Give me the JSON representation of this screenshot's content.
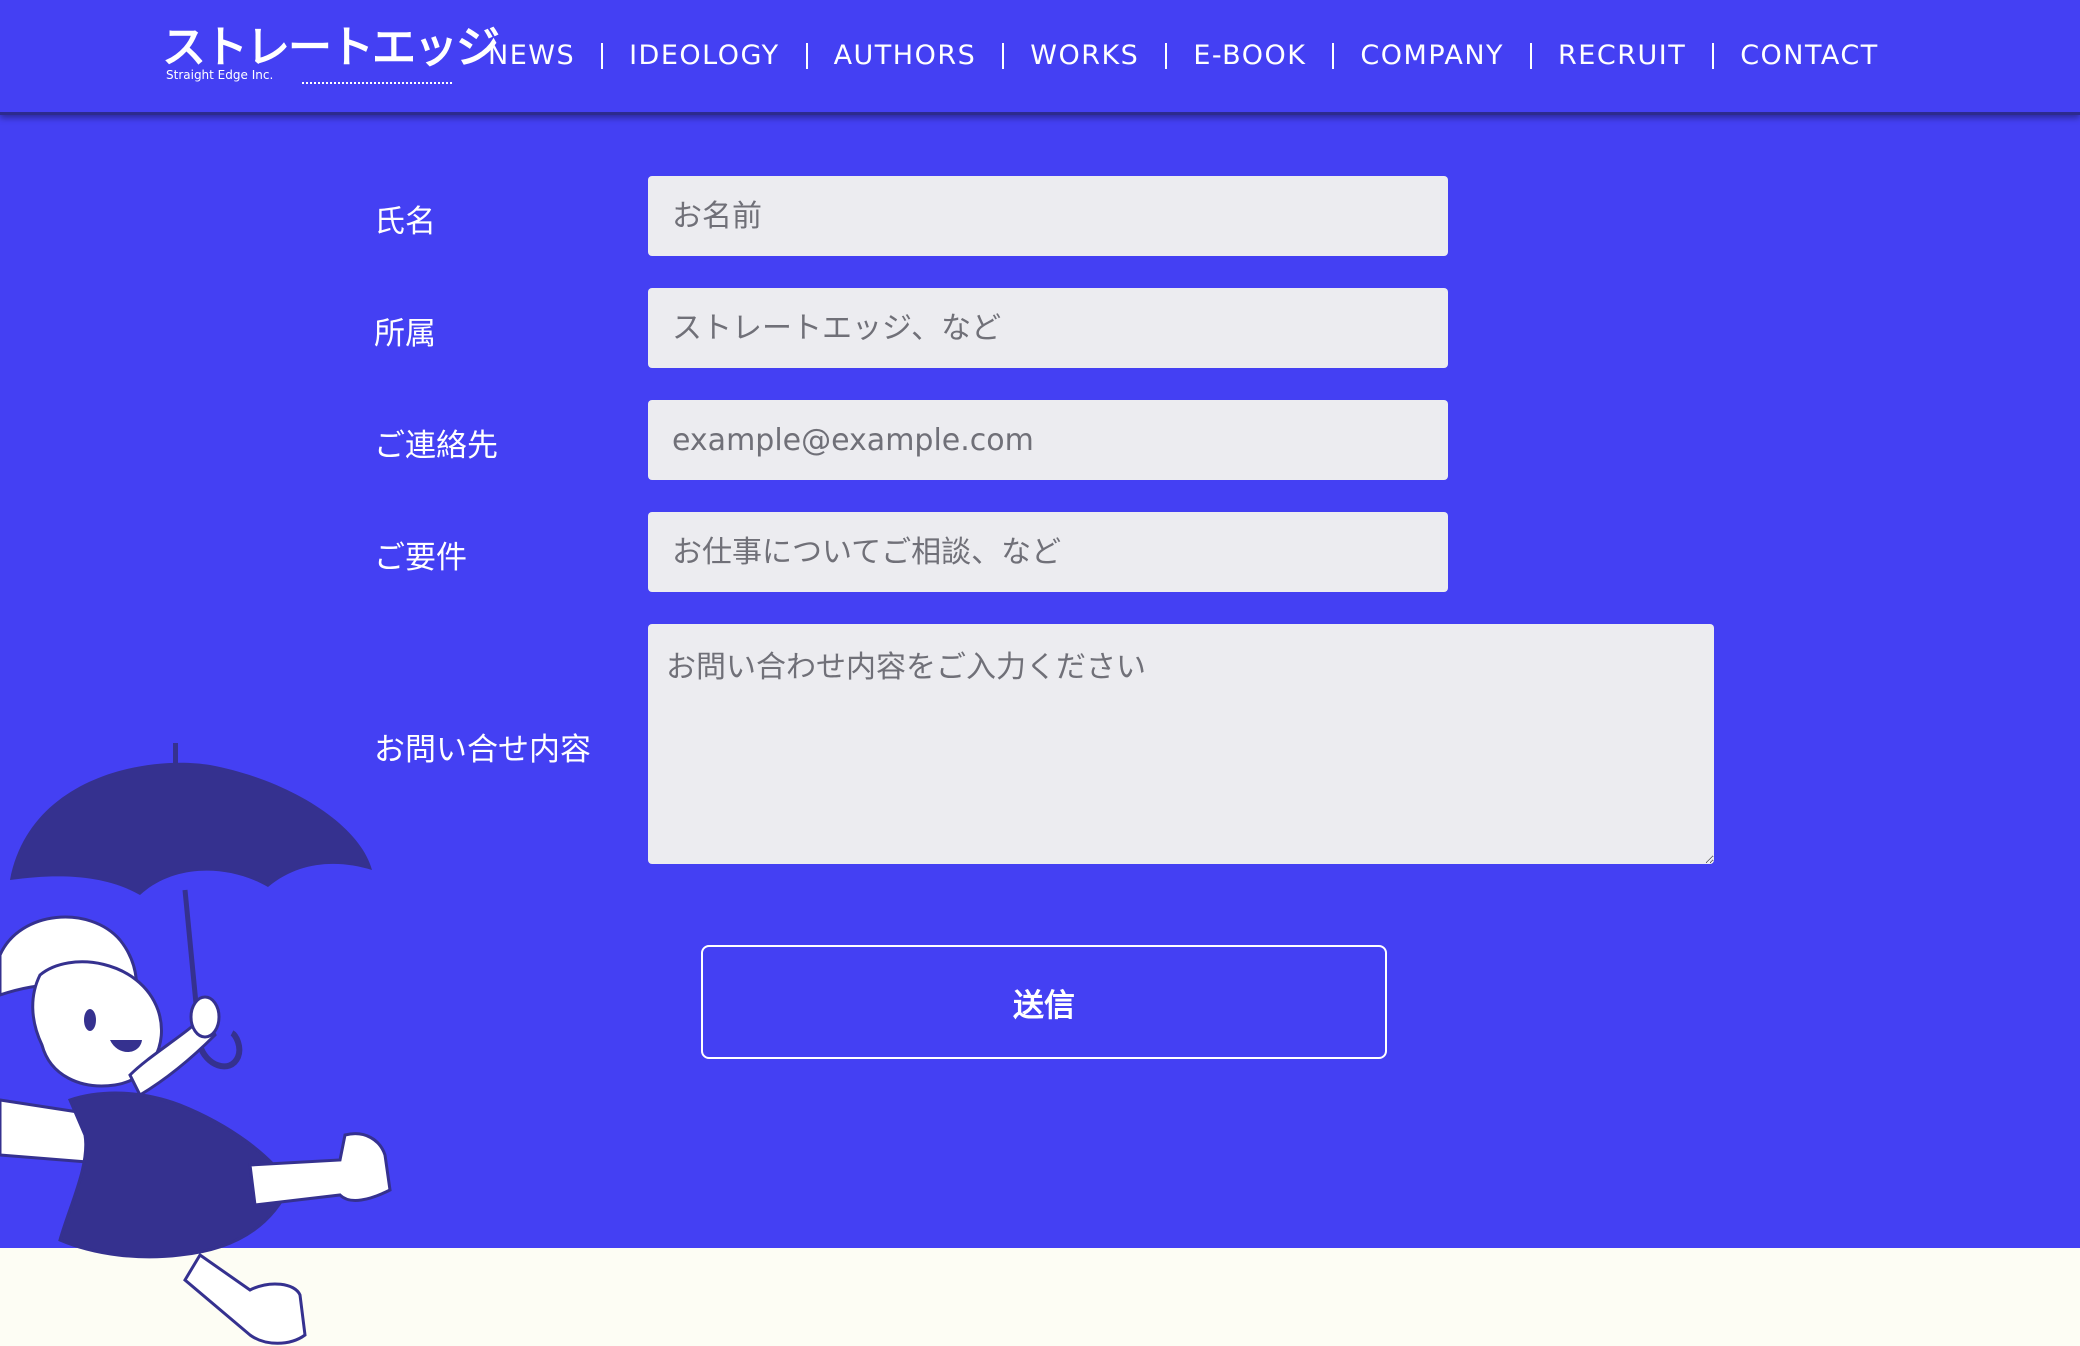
{
  "header": {
    "logo_text": "ストレートエッジ",
    "logo_subtext": "Straight Edge Inc.",
    "nav": [
      "NEWS",
      "IDEOLOGY",
      "AUTHORS",
      "WORKS",
      "E-BOOK",
      "COMPANY",
      "RECRUIT",
      "CONTACT"
    ]
  },
  "form": {
    "name_label": "氏名",
    "name_placeholder": "お名前",
    "affiliation_label": "所属",
    "affiliation_placeholder": "ストレートエッジ、など",
    "contact_label": "ご連絡先",
    "contact_placeholder": "example@example.com",
    "subject_label": "ご要件",
    "subject_placeholder": "お仕事についてご相談、など",
    "message_label": "お問い合せ内容",
    "message_placeholder": "お問い合わせ内容をご入力ください",
    "submit_label": "送信"
  },
  "colors": {
    "background": "#4440F3",
    "field_background": "#ECECF0",
    "illustration_fill": "#35318F",
    "footer_band": "#FDFDF4"
  }
}
